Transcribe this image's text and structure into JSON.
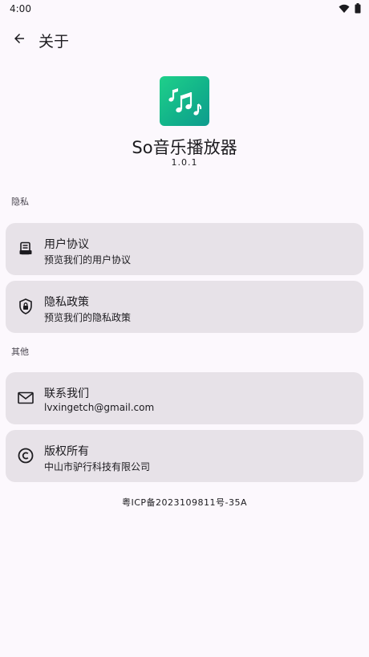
{
  "status": {
    "time": "4:00"
  },
  "appbar": {
    "title": "关于"
  },
  "app": {
    "name": "So音乐播放器",
    "version": "1.0.1"
  },
  "sections": {
    "privacy_label": "隐私",
    "other_label": "其他"
  },
  "items": [
    {
      "title": "用户协议",
      "subtitle": "预览我们的用户协议",
      "icon": "document-icon"
    },
    {
      "title": "隐私政策",
      "subtitle": "预览我们的隐私政策",
      "icon": "shield-lock-icon"
    },
    {
      "title": "联系我们",
      "subtitle": "lvxingetch@gmail.com",
      "icon": "mail-icon"
    },
    {
      "title": "版权所有",
      "subtitle": "中山市驴行科技有限公司",
      "icon": "copyright-icon"
    }
  ],
  "footer": {
    "icp": "粤ICP备2023109811号-35A"
  },
  "colors": {
    "background": "#fcf8fd",
    "card": "#e7e2e8",
    "app_icon_gradient_start": "#1fd08a",
    "app_icon_gradient_end": "#0e9b8e"
  }
}
